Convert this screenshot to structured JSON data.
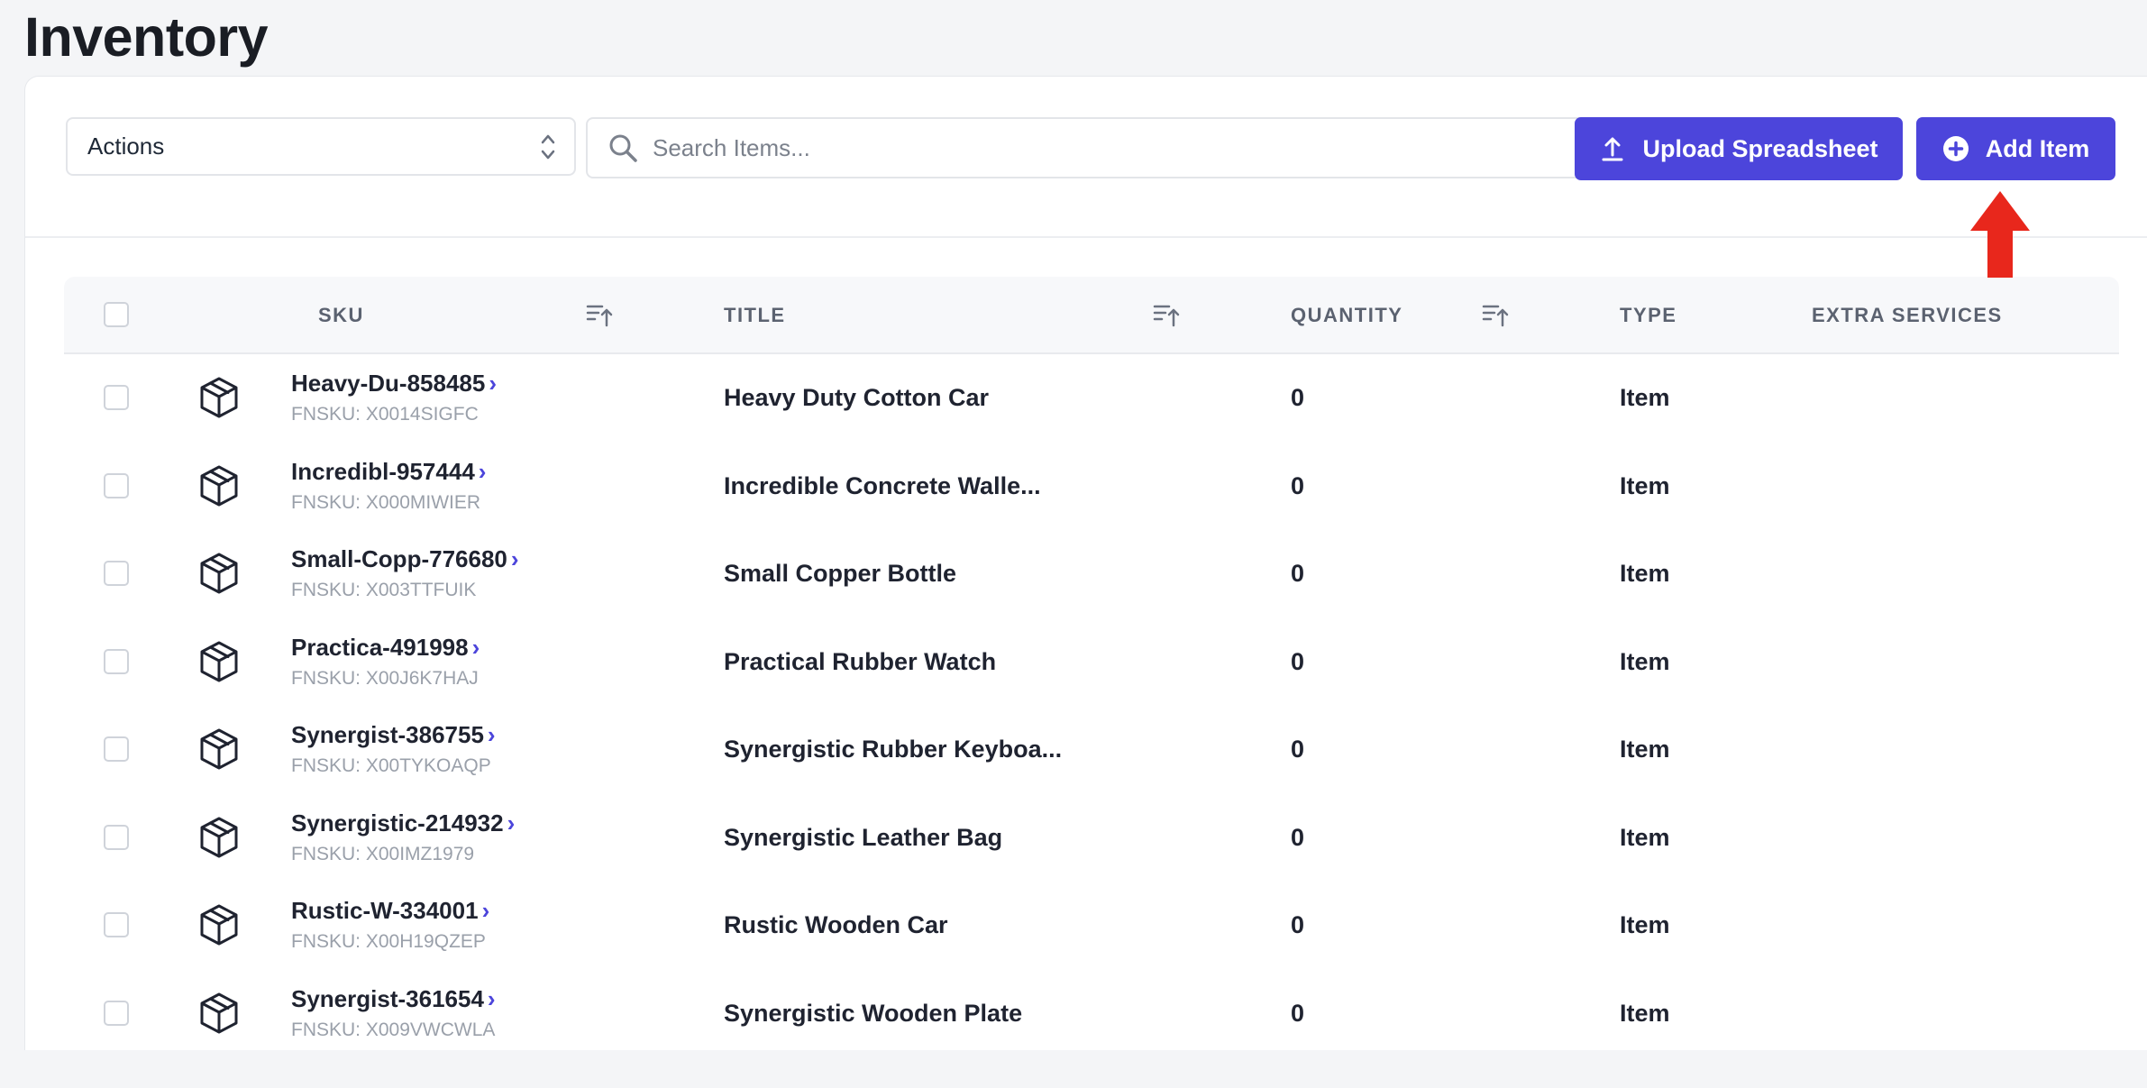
{
  "page": {
    "title": "Inventory"
  },
  "toolbar": {
    "actions_label": "Actions",
    "search_placeholder": "Search Items...",
    "upload_label": "Upload Spreadsheet",
    "add_label": "Add Item",
    "button_color": "#4c45db",
    "annotation_color": "#e8271c"
  },
  "table": {
    "columns": {
      "sku": "SKU",
      "title": "TITLE",
      "quantity": "QUANTITY",
      "type": "TYPE",
      "extra_services": "EXTRA SERVICES"
    },
    "rows": [
      {
        "sku": "Heavy-Du-858485",
        "fnsku": "FNSKU: X0014SIGFC",
        "title": "Heavy Duty Cotton Car",
        "quantity": "0",
        "type": "Item"
      },
      {
        "sku": "Incredibl-957444",
        "fnsku": "FNSKU: X000MIWIER",
        "title": "Incredible Concrete Walle...",
        "quantity": "0",
        "type": "Item"
      },
      {
        "sku": "Small-Copp-776680",
        "fnsku": "FNSKU: X003TTFUIK",
        "title": "Small Copper Bottle",
        "quantity": "0",
        "type": "Item"
      },
      {
        "sku": "Practica-491998",
        "fnsku": "FNSKU: X00J6K7HAJ",
        "title": "Practical Rubber Watch",
        "quantity": "0",
        "type": "Item"
      },
      {
        "sku": "Synergist-386755",
        "fnsku": "FNSKU: X00TYKOAQP",
        "title": "Synergistic Rubber Keyboa...",
        "quantity": "0",
        "type": "Item"
      },
      {
        "sku": "Synergistic-214932",
        "fnsku": "FNSKU: X00IMZ1979",
        "title": "Synergistic Leather Bag",
        "quantity": "0",
        "type": "Item"
      },
      {
        "sku": "Rustic-W-334001",
        "fnsku": "FNSKU: X00H19QZEP",
        "title": "Rustic Wooden Car",
        "quantity": "0",
        "type": "Item"
      },
      {
        "sku": "Synergist-361654",
        "fnsku": "FNSKU: X009VWCWLA",
        "title": "Synergistic Wooden Plate",
        "quantity": "0",
        "type": "Item"
      }
    ]
  }
}
